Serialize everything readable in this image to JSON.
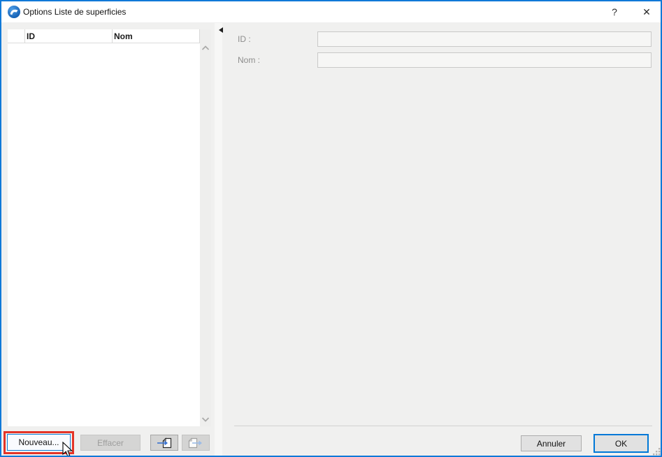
{
  "window": {
    "title": "Options Liste de superficies",
    "help_glyph": "?",
    "close_glyph": "✕"
  },
  "list_panel": {
    "columns": [
      {
        "label": "ID"
      },
      {
        "label": "Nom"
      }
    ],
    "rows": [],
    "buttons": {
      "new_label": "Nouveau...",
      "delete_label": "Effacer"
    },
    "icon_buttons": [
      {
        "name": "import-item",
        "enabled": true
      },
      {
        "name": "export-item",
        "enabled": false
      }
    ]
  },
  "detail_panel": {
    "fields": [
      {
        "label": "ID :",
        "value": ""
      },
      {
        "label": "Nom :",
        "value": ""
      }
    ]
  },
  "footer": {
    "cancel_label": "Annuler",
    "ok_label": "OK"
  },
  "colors": {
    "accent_blue": "#0078d7",
    "window_border_blue": "#1079d8",
    "annotation_red": "#e43427",
    "dialog_bg": "#f0f0ef",
    "titlebar_bg": "#ffffff",
    "disabled_button_bg": "#d5d5d4",
    "disabled_field_bg": "#f6f6f5"
  }
}
